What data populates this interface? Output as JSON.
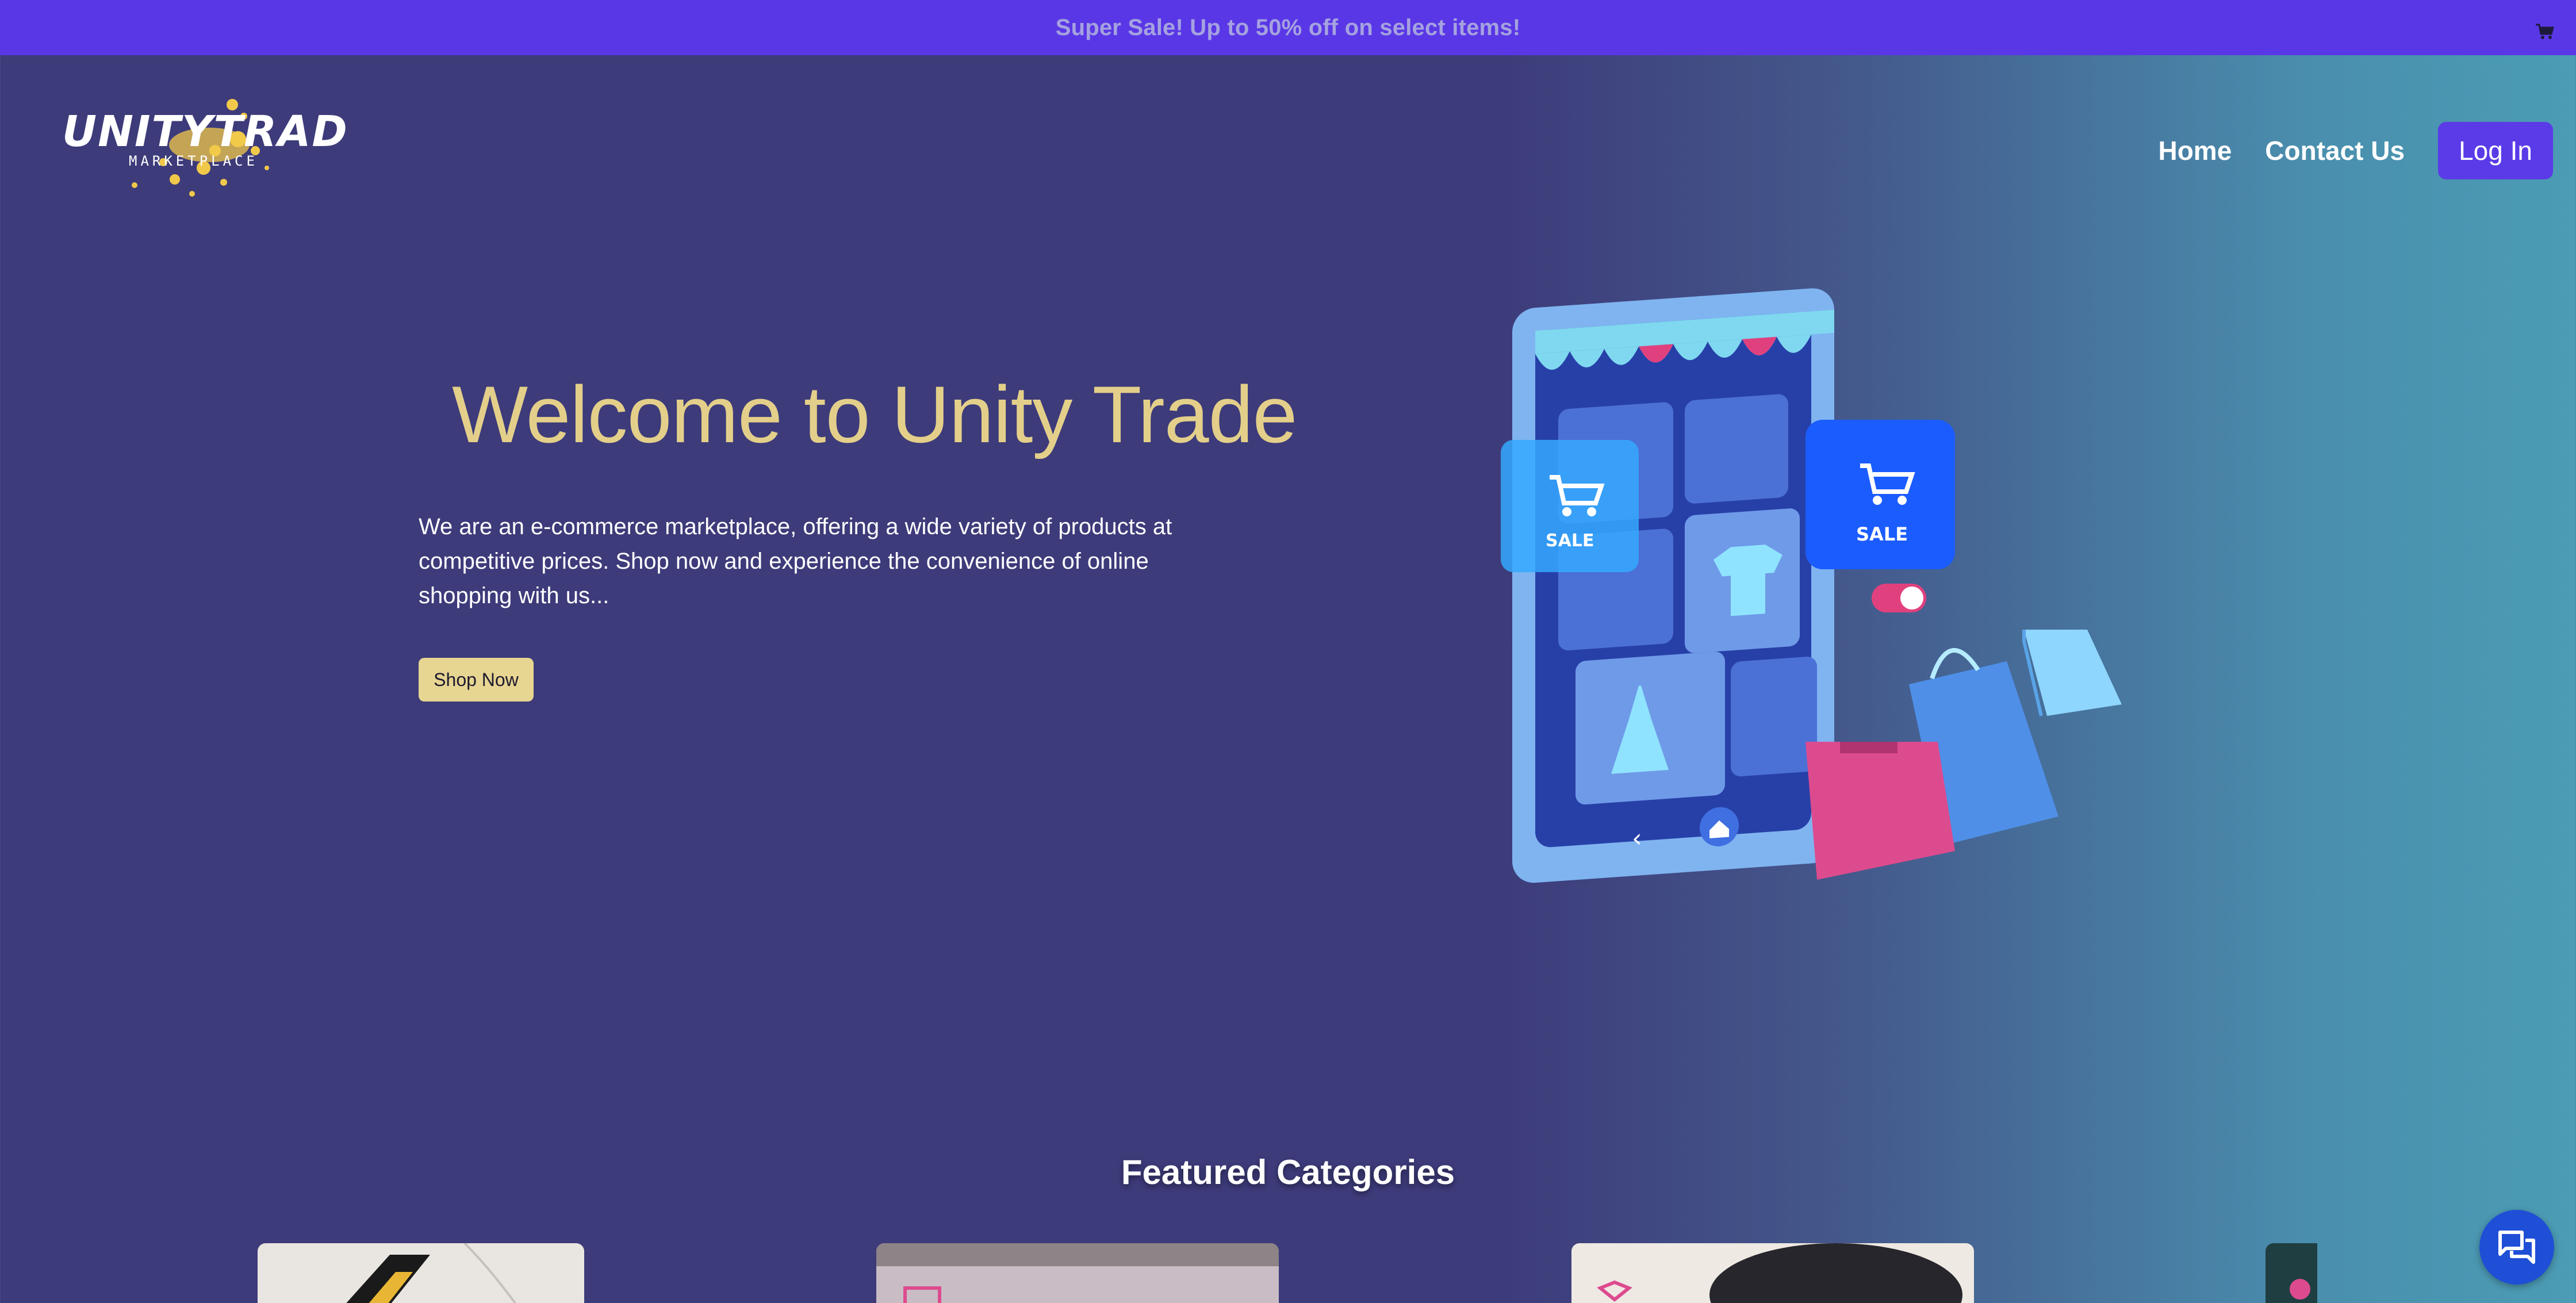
{
  "announcement": {
    "text": "Super Sale! Up to 50% off on select items!"
  },
  "header": {
    "logo_text": "UNITYTRADE",
    "logo_subtext": "MARKETPLACE",
    "nav": [
      {
        "label": "Home"
      },
      {
        "label": "Contact Us"
      }
    ],
    "login_label": "Log In"
  },
  "hero": {
    "title": "Welcome to Unity Trade",
    "description": "We are an e-commerce marketplace, offering a wide variety of products at competitive prices. Shop now and experience the convenience of online shopping with us...",
    "cta_label": "Shop Now",
    "illustration": {
      "sale_badge_left": "SALE",
      "sale_badge_right": "SALE"
    }
  },
  "featured": {
    "title": "Featured Categories"
  },
  "icons": {
    "cart": "cart-icon",
    "chat": "chat-icon"
  },
  "colors": {
    "announcement_bg": "#5a37e6",
    "accent_gold": "#e3cf8a",
    "login_bg": "#5b3be8",
    "chat_bg": "#1f4fd6"
  }
}
